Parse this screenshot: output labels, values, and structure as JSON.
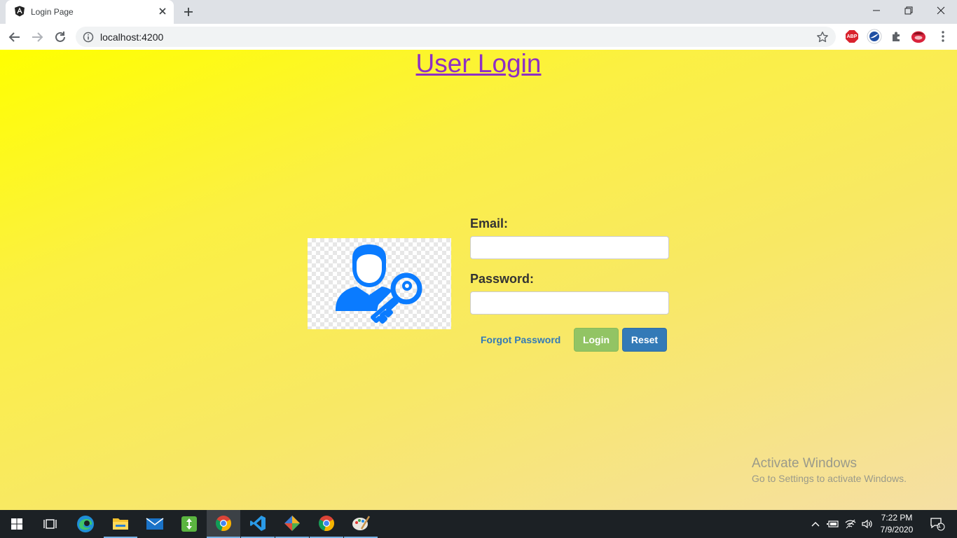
{
  "browser": {
    "tab_title": "Login Page",
    "url": "localhost:4200",
    "extensions": {
      "abp_label": "ABP"
    }
  },
  "page": {
    "title": "User Login",
    "email_label": "Email:",
    "email_value": "",
    "password_label": "Password:",
    "password_value": "",
    "forgot_link": "Forgot Password",
    "login_button": "Login",
    "reset_button": "Reset"
  },
  "watermark": {
    "title": "Activate Windows",
    "subtitle": "Go to Settings to activate Windows."
  },
  "taskbar": {
    "time": "7:22 PM",
    "date": "7/9/2020",
    "notification_count": "1",
    "apps": [
      "windows-start",
      "task-view",
      "edge",
      "file-explorer",
      "mail",
      "app-green",
      "chrome",
      "vscode",
      "git",
      "chrome",
      "paint"
    ]
  },
  "colors": {
    "title_link": "#8e2fc4",
    "login_button": "#92c464",
    "reset_button": "#337ab7",
    "icon_blue": "#0a7bff"
  }
}
